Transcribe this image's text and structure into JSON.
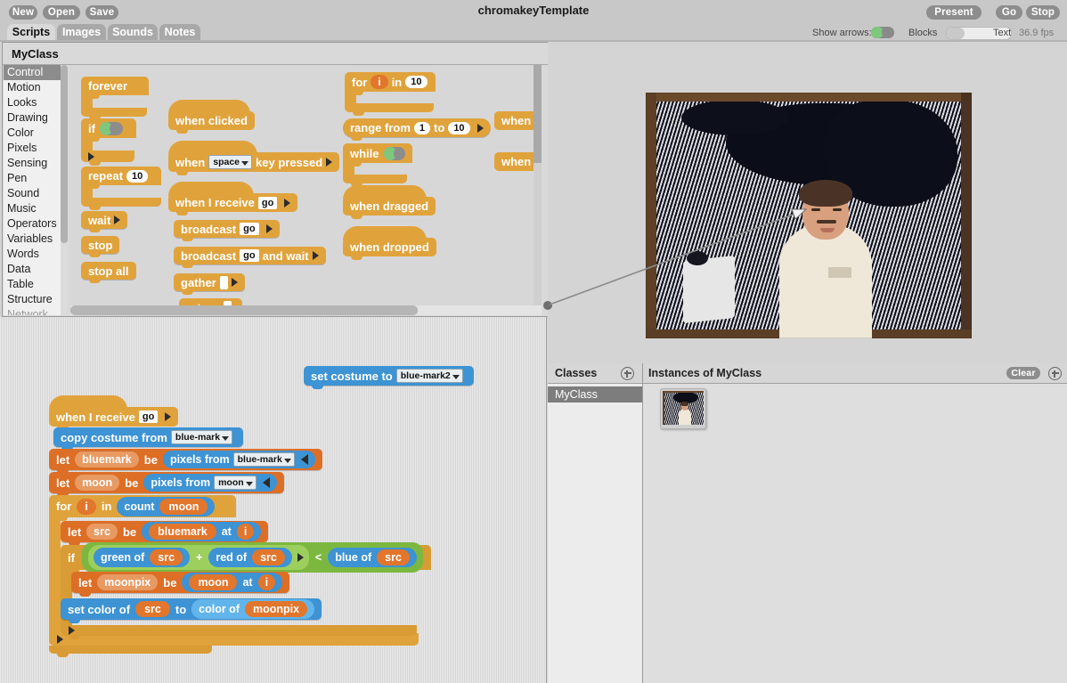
{
  "window": {
    "title": "chromakeyTemplate"
  },
  "toolbar": {
    "left_buttons": [
      {
        "label": "New",
        "name": "new-button"
      },
      {
        "label": "Open",
        "name": "open-button"
      },
      {
        "label": "Save",
        "name": "save-button"
      }
    ],
    "right_buttons": [
      {
        "label": "Present",
        "name": "present-button"
      },
      {
        "label": "Go",
        "name": "go-button"
      },
      {
        "label": "Stop",
        "name": "stop-button"
      }
    ],
    "show_arrows_label": "Show arrows:",
    "show_arrows_on": true,
    "blocks_label": "Blocks",
    "text_label": "Text",
    "fps": "36.9 fps"
  },
  "tabs": [
    {
      "label": "Scripts",
      "selected": true
    },
    {
      "label": "Images",
      "selected": false
    },
    {
      "label": "Sounds",
      "selected": false
    },
    {
      "label": "Notes",
      "selected": false
    }
  ],
  "scripts_pane": {
    "class_name": "MyClass",
    "categories": [
      {
        "label": "Control",
        "selected": true
      },
      {
        "label": "Motion",
        "selected": false
      },
      {
        "label": "Looks",
        "selected": false
      },
      {
        "label": "Drawing",
        "selected": false
      },
      {
        "label": "Color",
        "selected": false
      },
      {
        "label": "Pixels",
        "selected": false
      },
      {
        "label": "Sensing",
        "selected": false
      },
      {
        "label": "Pen",
        "selected": false
      },
      {
        "label": "Sound",
        "selected": false
      },
      {
        "label": "Music",
        "selected": false
      },
      {
        "label": "Operators",
        "selected": false
      },
      {
        "label": "Variables",
        "selected": false
      },
      {
        "label": "Words",
        "selected": false
      },
      {
        "label": "Data",
        "selected": false
      },
      {
        "label": "Table",
        "selected": false
      },
      {
        "label": "Structure",
        "selected": false
      },
      {
        "label": "Network",
        "selected": false
      }
    ]
  },
  "palette": {
    "blocks": {
      "forever": "forever",
      "if": "if",
      "repeat": "repeat",
      "repeat_count": "10",
      "wait": "wait",
      "stop": "stop",
      "stop_all": "stop all",
      "when_clicked": "when clicked",
      "when_prefix": "when",
      "when_key_dropdown": "space",
      "when_key_suffix": "key pressed",
      "when_i_receive": "when I receive",
      "when_i_receive_msg": "go",
      "broadcast": "broadcast",
      "broadcast_msg": "go",
      "broadcast_and_wait": "broadcast",
      "broadcast_and_wait_msg": "go",
      "broadcast_and_wait_suffix": "and wait",
      "gather": "gather",
      "return": "return",
      "for": "for",
      "for_var": "i",
      "for_in": "in",
      "for_count": "10",
      "range_from": "range from",
      "range_start": "1",
      "range_to": "to",
      "range_end": "10",
      "while": "while",
      "when_dragged": "when dragged",
      "when_dropped": "when dropped",
      "when_window": "when wi",
      "when_screen": "when sc"
    }
  },
  "workspace": {
    "loose_block": {
      "label": "set costume to",
      "dropdown": "blue-mark2"
    },
    "script": {
      "hat": {
        "label": "when I receive",
        "msg": "go"
      },
      "rows": [
        {
          "kind": "copy-costume",
          "label": "copy costume from",
          "dropdown": "blue-mark"
        },
        {
          "kind": "let",
          "let": "let",
          "var": "bluemark",
          "be": "be",
          "reporter": "pixels from",
          "dropdown": "blue-mark"
        },
        {
          "kind": "let",
          "let": "let",
          "var": "moon",
          "be": "be",
          "reporter": "pixels from",
          "dropdown": "moon"
        }
      ],
      "for_loop": {
        "for": "for",
        "var": "i",
        "in": "in",
        "reporter": "count",
        "arg": "moon"
      },
      "inner": {
        "let_src": {
          "let": "let",
          "var": "src",
          "be": "be",
          "reporter": "bluemark",
          "at": "at",
          "index": "i"
        },
        "if": {
          "label": "if",
          "green_of": "green of",
          "green_arg": "src",
          "plus": "+",
          "red_of": "red of",
          "red_arg": "src",
          "less_than": "<",
          "blue_of": "blue of",
          "blue_arg": "src"
        },
        "let_moonpix": {
          "let": "let",
          "var": "moonpix",
          "be": "be",
          "reporter": "moon",
          "at": "at",
          "index": "i"
        },
        "set_color": {
          "label": "set color of",
          "arg": "src",
          "to": "to",
          "reporter": "color of",
          "reporter_arg": "moonpix"
        }
      }
    }
  },
  "classes_panel": {
    "title": "Classes",
    "add_icon": "plus-circle-icon",
    "items": [
      {
        "label": "MyClass",
        "selected": true
      }
    ]
  },
  "instances_panel": {
    "title": "Instances of MyClass",
    "clear_label": "Clear",
    "add_icon": "plus-circle-icon"
  },
  "colors": {
    "control": "#e0a33c",
    "pixels_blue": "#3d93d3",
    "variables_orange": "#dd6e26",
    "operators_green": "#74b03a",
    "toolbar_bg": "#c8c8c8",
    "toggle_green": "#7ec87e"
  }
}
